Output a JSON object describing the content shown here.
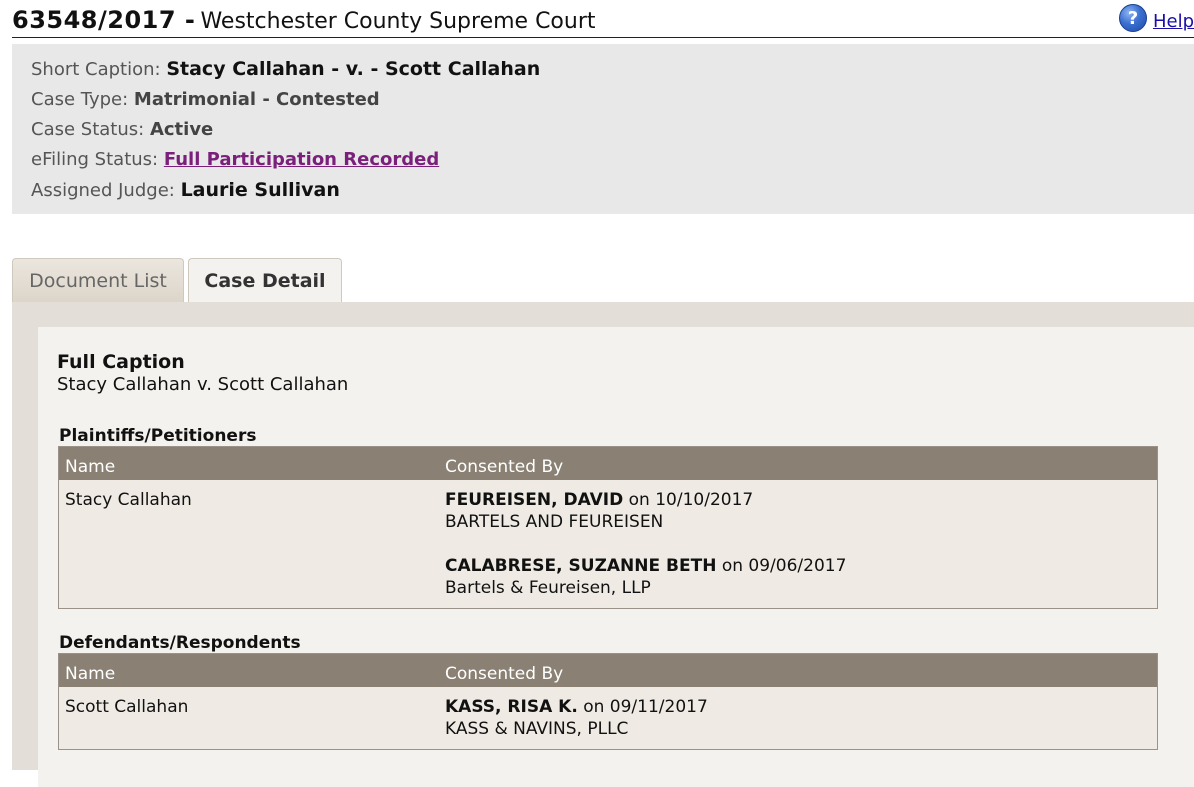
{
  "header": {
    "case_number": "63548/2017 -",
    "court": "Westchester County Supreme Court",
    "help_label": "Help"
  },
  "summary": {
    "short_caption_label": "Short Caption:",
    "short_caption": "Stacy Callahan - v. - Scott Callahan",
    "case_type_label": "Case Type:",
    "case_type": "Matrimonial - Contested",
    "case_status_label": "Case Status:",
    "case_status": "Active",
    "efiling_label": "eFiling Status:",
    "efiling_status": "Full Participation Recorded",
    "judge_label": "Assigned Judge:",
    "judge": "Laurie Sullivan"
  },
  "tabs": [
    {
      "label": "Document List",
      "active": false
    },
    {
      "label": "Case Detail",
      "active": true
    }
  ],
  "detail": {
    "full_caption_title": "Full Caption",
    "full_caption": "Stacy Callahan v. Scott Callahan",
    "plaintiffs": {
      "title": "Plaintiffs/Petitioners",
      "columns": [
        "Name",
        "Consented By"
      ],
      "rows": [
        {
          "name": "Stacy Callahan",
          "consents": [
            {
              "attorney": "FEUREISEN, DAVID",
              "on": "on 10/10/2017",
              "firm": "BARTELS AND FEUREISEN"
            },
            {
              "attorney": "CALABRESE, SUZANNE BETH",
              "on": "on 09/06/2017",
              "firm": "Bartels & Feureisen, LLP"
            }
          ]
        }
      ]
    },
    "defendants": {
      "title": "Defendants/Respondents",
      "columns": [
        "Name",
        "Consented By"
      ],
      "rows": [
        {
          "name": "Scott Callahan",
          "consents": [
            {
              "attorney": "KASS, RISA K.",
              "on": "on 09/11/2017",
              "firm": "KASS & NAVINS, PLLC"
            }
          ]
        }
      ]
    }
  },
  "colors": {
    "table_header": "#8a8174",
    "link_visited": "#7a1f7a",
    "summary_bg": "#e8e8e8"
  }
}
